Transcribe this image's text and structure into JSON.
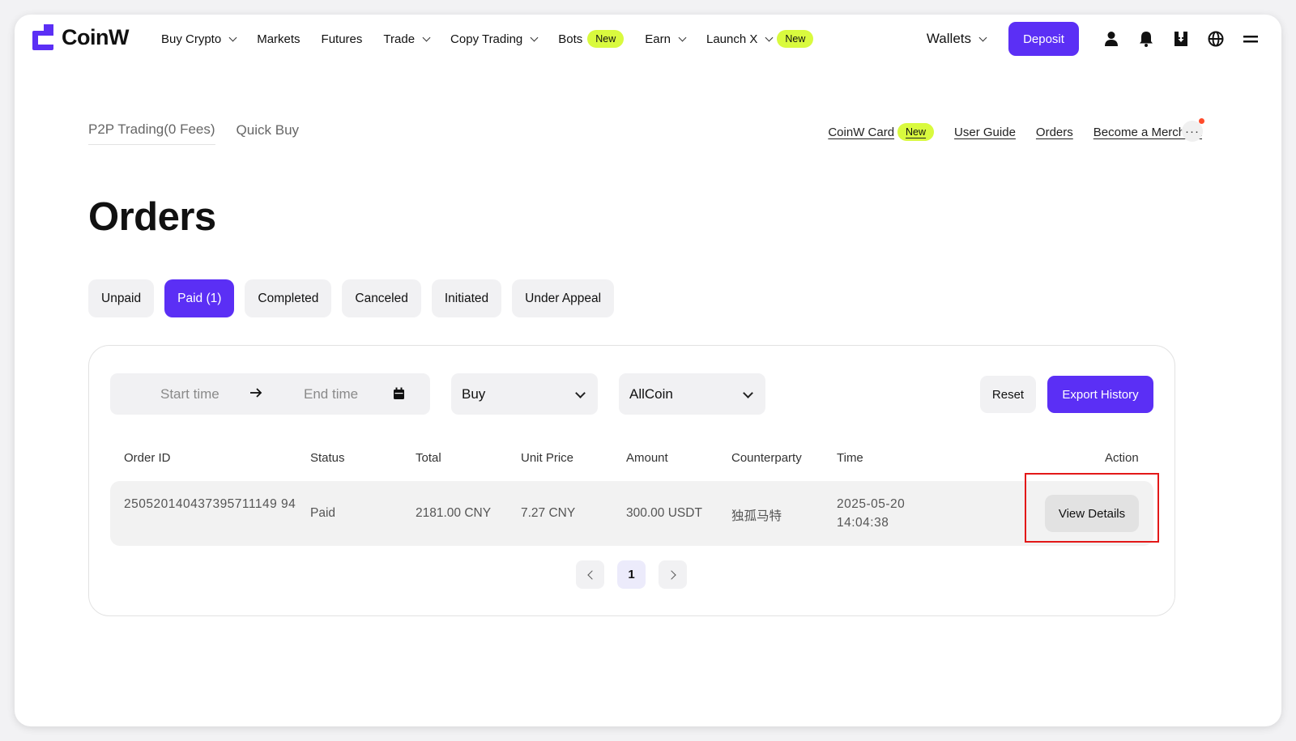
{
  "colors": {
    "brand": "#5b2ff5",
    "badge": "#d9fa3e",
    "highlight": "#e31818"
  },
  "header": {
    "logo": "CoinW",
    "nav": [
      {
        "label": "Buy Crypto",
        "dropdown": true
      },
      {
        "label": "Markets"
      },
      {
        "label": "Futures"
      },
      {
        "label": "Trade",
        "dropdown": true
      },
      {
        "label": "Copy Trading",
        "dropdown": true
      },
      {
        "label": "Bots",
        "badge": "New"
      },
      {
        "label": "Earn",
        "dropdown": true
      },
      {
        "label": "Launch X",
        "dropdown": true,
        "badge": "New"
      }
    ],
    "wallets": "Wallets",
    "deposit": "Deposit",
    "icons": [
      "user-icon",
      "bell-icon",
      "download-icon",
      "globe-icon",
      "menu-icon"
    ]
  },
  "subnav": {
    "tabs": [
      "P2P Trading(0 Fees)",
      "Quick Buy"
    ],
    "links": [
      "CoinW Card",
      "User Guide",
      "Orders",
      "Become a Merchant"
    ],
    "card_badge": "New",
    "more": "···"
  },
  "page": {
    "title": "Orders"
  },
  "status_tabs": [
    {
      "label": "Unpaid",
      "active": false
    },
    {
      "label": "Paid (1)",
      "active": true
    },
    {
      "label": "Completed",
      "active": false
    },
    {
      "label": "Canceled",
      "active": false
    },
    {
      "label": "Initiated",
      "active": false
    },
    {
      "label": "Under Appeal",
      "active": false
    }
  ],
  "filters": {
    "start_placeholder": "Start time",
    "end_placeholder": "End time",
    "type": "Buy",
    "coin": "AllCoin",
    "reset": "Reset",
    "export": "Export History"
  },
  "table": {
    "columns": [
      "Order ID",
      "Status",
      "Total",
      "Unit Price",
      "Amount",
      "Counterparty",
      "Time",
      "Action"
    ],
    "rows": [
      {
        "order_id": "250520140437395711149 94",
        "status": "Paid",
        "total": "2181.00 CNY",
        "unit_price": "7.27 CNY",
        "amount": "300.00 USDT",
        "counterparty": "独孤马特",
        "time_date": "2025-05-20",
        "time_clock": "14:04:38",
        "action": "View Details"
      }
    ]
  },
  "pagination": {
    "current": "1"
  }
}
